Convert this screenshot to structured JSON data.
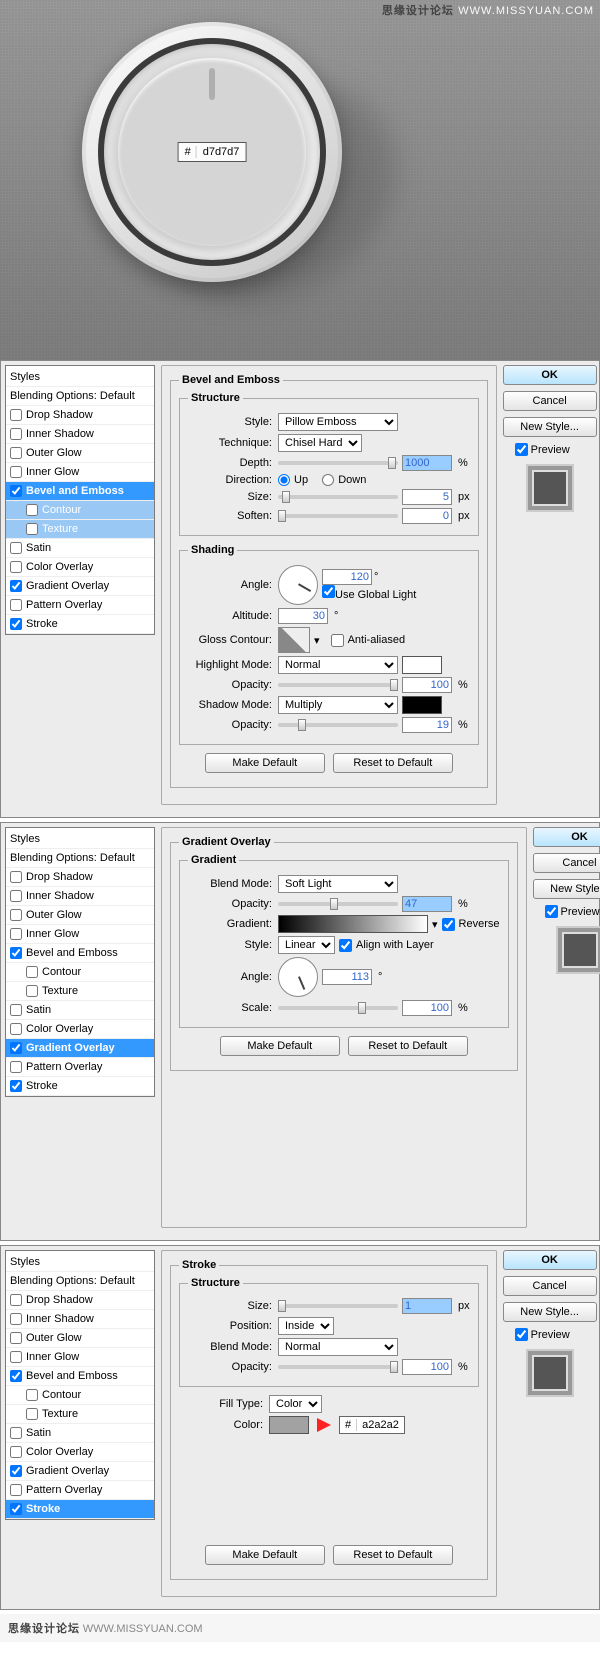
{
  "hero": {
    "hash": "#",
    "hex": "d7d7d7",
    "wm1": "思缘设计论坛",
    "wm2": "WWW.MISSYUAN.COM"
  },
  "common": {
    "styles_header": "Styles",
    "blend_options": "Blending Options: Default",
    "ok": "OK",
    "cancel": "Cancel",
    "newstyle": "New Style...",
    "preview": "Preview",
    "make_default": "Make Default",
    "reset_default": "Reset to Default"
  },
  "effects": [
    "Drop Shadow",
    "Inner Shadow",
    "Outer Glow",
    "Inner Glow",
    "Bevel and Emboss",
    "Contour",
    "Texture",
    "Satin",
    "Color Overlay",
    "Gradient Overlay",
    "Pattern Overlay",
    "Stroke"
  ],
  "panel1": {
    "checked": [
      "Bevel and Emboss",
      "Gradient Overlay",
      "Stroke"
    ],
    "selected": "Bevel and Emboss",
    "title": "Bevel and Emboss",
    "structure": "Structure",
    "style": "Pillow Emboss",
    "style_lbl": "Style:",
    "technique": "Chisel Hard",
    "technique_lbl": "Technique:",
    "depth_lbl": "Depth:",
    "depth": "1000",
    "pct": "%",
    "direction_lbl": "Direction:",
    "up": "Up",
    "down": "Down",
    "size_lbl": "Size:",
    "size": "5",
    "px": "px",
    "soften_lbl": "Soften:",
    "soften": "0",
    "shading": "Shading",
    "angle_lbl": "Angle:",
    "angle": "120",
    "deg": "°",
    "global": "Use Global Light",
    "altitude_lbl": "Altitude:",
    "altitude": "30",
    "gloss_lbl": "Gloss Contour:",
    "anti": "Anti-aliased",
    "hmode_lbl": "Highlight Mode:",
    "hmode": "Normal",
    "hopacity_lbl": "Opacity:",
    "hopacity": "100",
    "smode_lbl": "Shadow Mode:",
    "smode": "Multiply",
    "sopacity": "19"
  },
  "panel2": {
    "selected": "Gradient Overlay",
    "title": "Gradient Overlay",
    "gradient": "Gradient",
    "blend_lbl": "Blend Mode:",
    "blend_mode": "Soft Light",
    "opacity_lbl": "Opacity:",
    "opacity": "47",
    "pct": "%",
    "gradient_lbl": "Gradient:",
    "reverse": "Reverse",
    "style_lbl": "Style:",
    "style": "Linear",
    "align": "Align with Layer",
    "angle_lbl": "Angle:",
    "angle": "113",
    "deg": "°",
    "scale_lbl": "Scale:",
    "scale": "100"
  },
  "panel3": {
    "selected": "Stroke",
    "title": "Stroke",
    "structure": "Structure",
    "size_lbl": "Size:",
    "size": "1",
    "px": "px",
    "position_lbl": "Position:",
    "position": "Inside",
    "blend_lbl": "Blend Mode:",
    "blend_mode": "Normal",
    "opacity_lbl": "Opacity:",
    "opacity": "100",
    "pct": "%",
    "filltype_lbl": "Fill Type:",
    "filltype": "Color",
    "color_lbl": "Color:",
    "hash": "#",
    "hex": "a2a2a2"
  },
  "footer": {
    "wm1": "思缘设计论坛",
    "wm2": "WWW.MISSYUAN.COM"
  }
}
